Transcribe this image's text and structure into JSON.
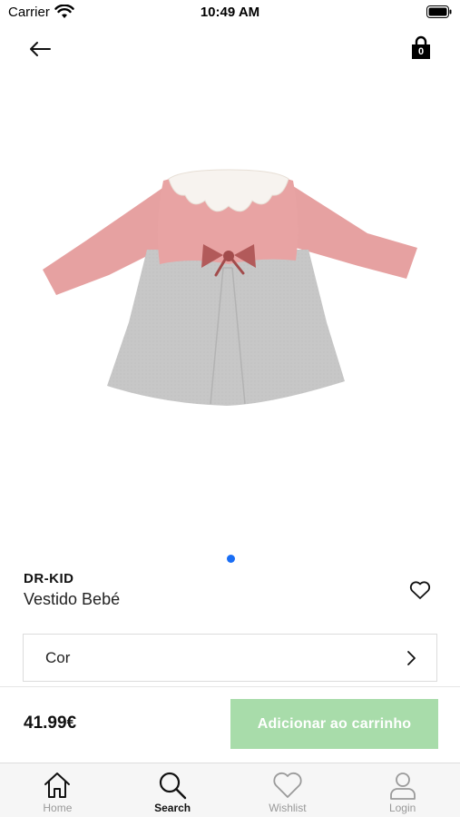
{
  "status_bar": {
    "carrier": "Carrier",
    "time": "10:49 AM"
  },
  "header": {
    "back_icon": "arrow-left-icon",
    "cart_icon": "shopping-bag-icon",
    "cart_count": "0"
  },
  "product": {
    "brand": "DR-KID",
    "name": "Vestido Bebé",
    "image": "pink-grey-baby-dress-photo",
    "carousel": {
      "total": 1,
      "active_index": 0
    },
    "wishlist_icon": "heart-outline-icon",
    "option": {
      "label": "Cor",
      "icon": "chevron-right-icon"
    },
    "price": "41.99€"
  },
  "actions": {
    "add_to_cart": "Adicionar ao carrinho"
  },
  "tab_bar": {
    "tabs": [
      {
        "label": "Home",
        "icon": "home-icon",
        "active": false
      },
      {
        "label": "Search",
        "icon": "search-icon",
        "active": true
      },
      {
        "label": "Wishlist",
        "icon": "heart-icon",
        "active": false
      },
      {
        "label": "Login",
        "icon": "user-icon",
        "active": false
      }
    ]
  },
  "colors": {
    "accent_blue": "#1a6ef5",
    "add_button": "#a8dcaa",
    "dress_pink": "#e8a3a3",
    "dress_grey": "#c8c8c8",
    "bow": "#b25a5a"
  }
}
